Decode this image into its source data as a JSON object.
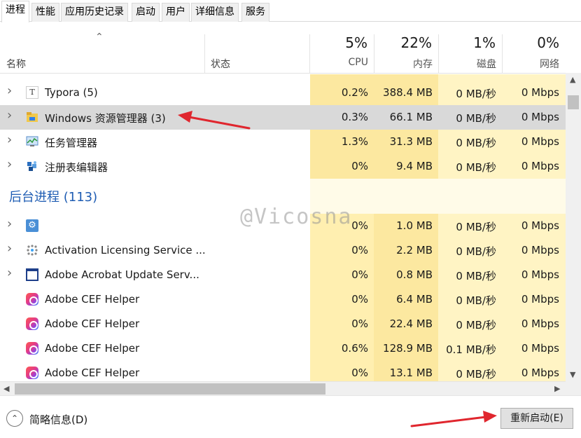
{
  "tabs": [
    "进程",
    "性能",
    "应用历史记录",
    "启动",
    "用户",
    "详细信息",
    "服务"
  ],
  "active_tab": 0,
  "header": {
    "name": "名称",
    "status": "状态",
    "cpu_pct": "5%",
    "cpu_label": "CPU",
    "mem_pct": "22%",
    "mem_label": "内存",
    "disk_pct": "1%",
    "disk_label": "磁盘",
    "net_pct": "0%",
    "net_label": "网络"
  },
  "apps": [
    {
      "name": "Typora (5)",
      "icon": "typora-icon",
      "cpu": "0.2%",
      "mem": "388.4 MB",
      "disk": "0 MB/秒",
      "net": "0 Mbps",
      "expandable": true
    },
    {
      "name": "Windows 资源管理器 (3)",
      "icon": "folder-icon",
      "cpu": "0.3%",
      "mem": "66.1 MB",
      "disk": "0 MB/秒",
      "net": "0 Mbps",
      "expandable": true,
      "selected": true
    },
    {
      "name": "任务管理器",
      "icon": "task-manager-icon",
      "cpu": "1.3%",
      "mem": "31.3 MB",
      "disk": "0 MB/秒",
      "net": "0 Mbps",
      "expandable": true
    },
    {
      "name": "注册表编辑器",
      "icon": "registry-editor-icon",
      "cpu": "0%",
      "mem": "9.4 MB",
      "disk": "0 MB/秒",
      "net": "0 Mbps",
      "expandable": true
    }
  ],
  "background_group": {
    "title": "后台进程 (113)"
  },
  "background": [
    {
      "name": "",
      "icon": "gear-icon",
      "cpu": "0%",
      "mem": "1.0 MB",
      "disk": "0 MB/秒",
      "net": "0 Mbps",
      "expandable": true
    },
    {
      "name": "Activation Licensing Service ...",
      "icon": "licensing-service-icon",
      "cpu": "0%",
      "mem": "2.2 MB",
      "disk": "0 MB/秒",
      "net": "0 Mbps",
      "expandable": true
    },
    {
      "name": "Adobe Acrobat Update Serv...",
      "icon": "window-icon",
      "cpu": "0%",
      "mem": "0.8 MB",
      "disk": "0 MB/秒",
      "net": "0 Mbps",
      "expandable": true
    },
    {
      "name": "Adobe CEF Helper",
      "icon": "adobe-cc-icon",
      "cpu": "0%",
      "mem": "6.4 MB",
      "disk": "0 MB/秒",
      "net": "0 Mbps",
      "expandable": false
    },
    {
      "name": "Adobe CEF Helper",
      "icon": "adobe-cc-icon",
      "cpu": "0%",
      "mem": "22.4 MB",
      "disk": "0 MB/秒",
      "net": "0 Mbps",
      "expandable": false
    },
    {
      "name": "Adobe CEF Helper",
      "icon": "adobe-cc-icon",
      "cpu": "0.6%",
      "mem": "128.9 MB",
      "disk": "0.1 MB/秒",
      "net": "0 Mbps",
      "expandable": false
    },
    {
      "name": "Adobe CEF Helper",
      "icon": "adobe-cc-icon",
      "cpu": "0%",
      "mem": "13.1 MB",
      "disk": "0 MB/秒",
      "net": "0 Mbps",
      "expandable": false
    }
  ],
  "footer": {
    "collapse_label": "简略信息(D)",
    "restart_label": "重新启动(E)"
  },
  "watermark": "@Vicosna",
  "colors": {
    "heat_light": "#fff4c4",
    "heat_medium": "#ffefb0",
    "heat_strong": "#fce8a0",
    "selected_row": "#d9d9d9",
    "group_title": "#1e5cb3",
    "annotation_arrow": "#e0262e"
  }
}
